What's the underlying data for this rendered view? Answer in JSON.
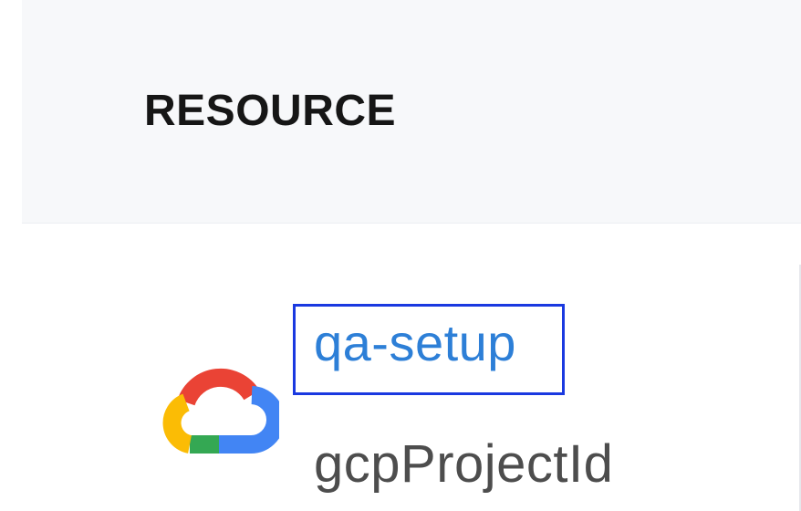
{
  "table": {
    "column_header": "RESOURCE"
  },
  "row": {
    "icon": "google-cloud-icon",
    "resource_name": "qa-setup",
    "resource_type": "gcpProjectId"
  },
  "colors": {
    "link": "#2d7fd7",
    "highlight_border": "#1a39e0",
    "header_bg": "#f7f8fa",
    "gcp_red": "#ea4335",
    "gcp_blue": "#4285f4",
    "gcp_yellow": "#fbbc05",
    "gcp_green": "#34a853"
  }
}
